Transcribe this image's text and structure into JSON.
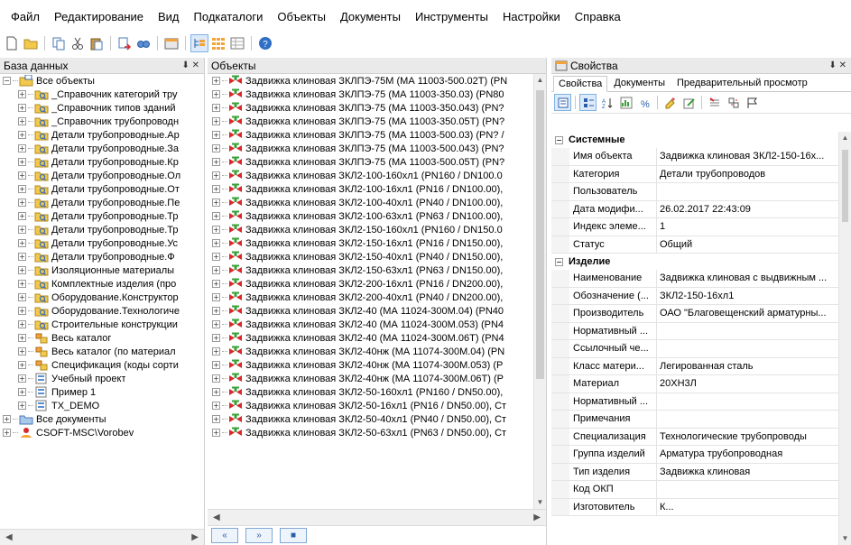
{
  "menu": [
    "Файл",
    "Редактирование",
    "Вид",
    "Подкаталоги",
    "Объекты",
    "Документы",
    "Инструменты",
    "Настройки",
    "Справка"
  ],
  "toolbar_icons": [
    "new-icon",
    "open-icon",
    "copy-icon",
    "cut-icon",
    "paste-icon",
    "move-icon",
    "find-icon",
    "properties-icon",
    "tree-view-icon",
    "grid-view-icon",
    "list-view-icon",
    "help-icon"
  ],
  "db_panel": {
    "title": "База данных",
    "pin": "p ×",
    "root": "Все объекты",
    "items": [
      "_Справочник категорий тру",
      "_Справочник типов зданий",
      "_Справочник трубопроводн",
      "Детали трубопроводные.Ар",
      "Детали трубопроводные.За",
      "Детали трубопроводные.Кр",
      "Детали трубопроводные.Ол",
      "Детали трубопроводные.От",
      "Детали трубопроводные.Пе",
      "Детали трубопроводные.Тр",
      "Детали трубопроводные.Тр",
      "Детали трубопроводные.Ус",
      "Детали трубопроводные.Ф",
      "Изоляционные материалы",
      "Комплектные изделия (про",
      "Оборудование.Конструктор",
      "Оборудование.Технологиче",
      "Строительные конструкции",
      "Весь каталог",
      "Весь каталог (по материал",
      "Спецификация (коды сорти",
      "Учебный проект",
      "Пример 1",
      "TX_DEMO"
    ],
    "item_kinds": [
      "f",
      "f",
      "f",
      "f",
      "f",
      "f",
      "f",
      "f",
      "f",
      "f",
      "f",
      "f",
      "f",
      "f",
      "f",
      "f",
      "f",
      "f",
      "c",
      "c",
      "c",
      "p",
      "p",
      "p"
    ],
    "docs": "Все документы",
    "user": "CSOFT-MSC\\Vorobev"
  },
  "objects_panel": {
    "title": "Объекты",
    "items": [
      "Задвижка клиновая ЗКЛПЭ-75М (МА 11003-500.02Т) (PN",
      "Задвижка клиновая ЗКЛПЭ-75 (МА 11003-350.03) (PN80",
      "Задвижка клиновая ЗКЛПЭ-75 (МА 11003-350.043) (PN?",
      "Задвижка клиновая ЗКЛПЭ-75 (МА 11003-350.05Т) (PN?",
      "Задвижка клиновая ЗКЛПЭ-75 (МА 11003-500.03) (PN? /",
      "Задвижка клиновая ЗКЛПЭ-75 (МА 11003-500.043) (PN?",
      "Задвижка клиновая ЗКЛПЭ-75 (МА 11003-500.05Т) (PN?",
      "Задвижка клиновая ЗКЛ2-100-160хл1 (PN160 / DN100.0",
      "Задвижка клиновая ЗКЛ2-100-16хл1 (PN16 / DN100.00),",
      "Задвижка клиновая ЗКЛ2-100-40хл1 (PN40 / DN100.00),",
      "Задвижка клиновая ЗКЛ2-100-63хл1 (PN63 / DN100.00),",
      "Задвижка клиновая ЗКЛ2-150-160хл1 (PN160 / DN150.0",
      "Задвижка клиновая ЗКЛ2-150-16хл1 (PN16 / DN150.00),",
      "Задвижка клиновая ЗКЛ2-150-40хл1 (PN40 / DN150.00),",
      "Задвижка клиновая ЗКЛ2-150-63хл1 (PN63 / DN150.00),",
      "Задвижка клиновая ЗКЛ2-200-16хл1 (PN16 / DN200.00),",
      "Задвижка клиновая ЗКЛ2-200-40хл1 (PN40 / DN200.00),",
      "Задвижка клиновая ЗКЛ2-40 (МА 11024-300М.04) (PN40",
      "Задвижка клиновая ЗКЛ2-40 (МА 11024-300М.053) (PN4",
      "Задвижка клиновая ЗКЛ2-40 (МА 11024-300М.06Т) (PN4",
      "Задвижка клиновая ЗКЛ2-40нж (МА 11074-300М.04) (PN",
      "Задвижка клиновая ЗКЛ2-40нж (МА 11074-300М.053) (Р",
      "Задвижка клиновая ЗКЛ2-40нж (МА 11074-300М.06Т) (Р",
      "Задвижка клиновая ЗКЛ2-50-160хл1 (PN160 / DN50.00),",
      "Задвижка клиновая ЗКЛ2-50-16хл1 (PN16 / DN50.00), Ст",
      "Задвижка клиновая ЗКЛ2-50-40хл1 (PN40 / DN50.00), Ст",
      "Задвижка клиновая ЗКЛ2-50-63хл1 (PN63 / DN50.00), Ст"
    ],
    "nav": [
      "«",
      "»",
      "■"
    ]
  },
  "props_panel": {
    "title": "Свойства",
    "tabs": [
      "Свойства",
      "Документы",
      "Предварительный просмотр"
    ],
    "categories": [
      {
        "name": "Системные",
        "rows": [
          [
            "Имя объекта",
            "Задвижка клиновая ЗКЛ2-150-16х..."
          ],
          [
            "Категория",
            "Детали трубопроводов"
          ],
          [
            "Пользователь",
            ""
          ],
          [
            "Дата модифи...",
            "26.02.2017 22:43:09"
          ],
          [
            "Индекс элеме...",
            "1"
          ],
          [
            "Статус",
            "Общий"
          ]
        ]
      },
      {
        "name": "Изделие",
        "rows": [
          [
            "Наименование",
            "Задвижка клиновая с выдвижным ..."
          ],
          [
            "Обозначение (...",
            "ЗКЛ2-150-16хл1"
          ],
          [
            "Производитель",
            "ОАО \"Благовещенский арматурны..."
          ],
          [
            "Нормативный ...",
            ""
          ],
          [
            "Ссылочный че...",
            ""
          ],
          [
            "Класс матери...",
            "Легированная сталь"
          ],
          [
            "Материал",
            "20ХН3Л"
          ],
          [
            "Нормативный ...",
            ""
          ],
          [
            "Примечания",
            ""
          ],
          [
            "Специализация",
            "Технологические трубопроводы"
          ],
          [
            "Группа изделий",
            "Арматура трубопроводная"
          ],
          [
            "Тип изделия",
            "Задвижка клиновая"
          ],
          [
            "Код ОКП",
            ""
          ],
          [
            "Изготовитель",
            "К..."
          ]
        ]
      }
    ]
  },
  "colors": {
    "valve_red": "#d8282c",
    "valve_green": "#3aa13a",
    "folder": "#f2c94c",
    "title_bg": "#eaeaea"
  }
}
